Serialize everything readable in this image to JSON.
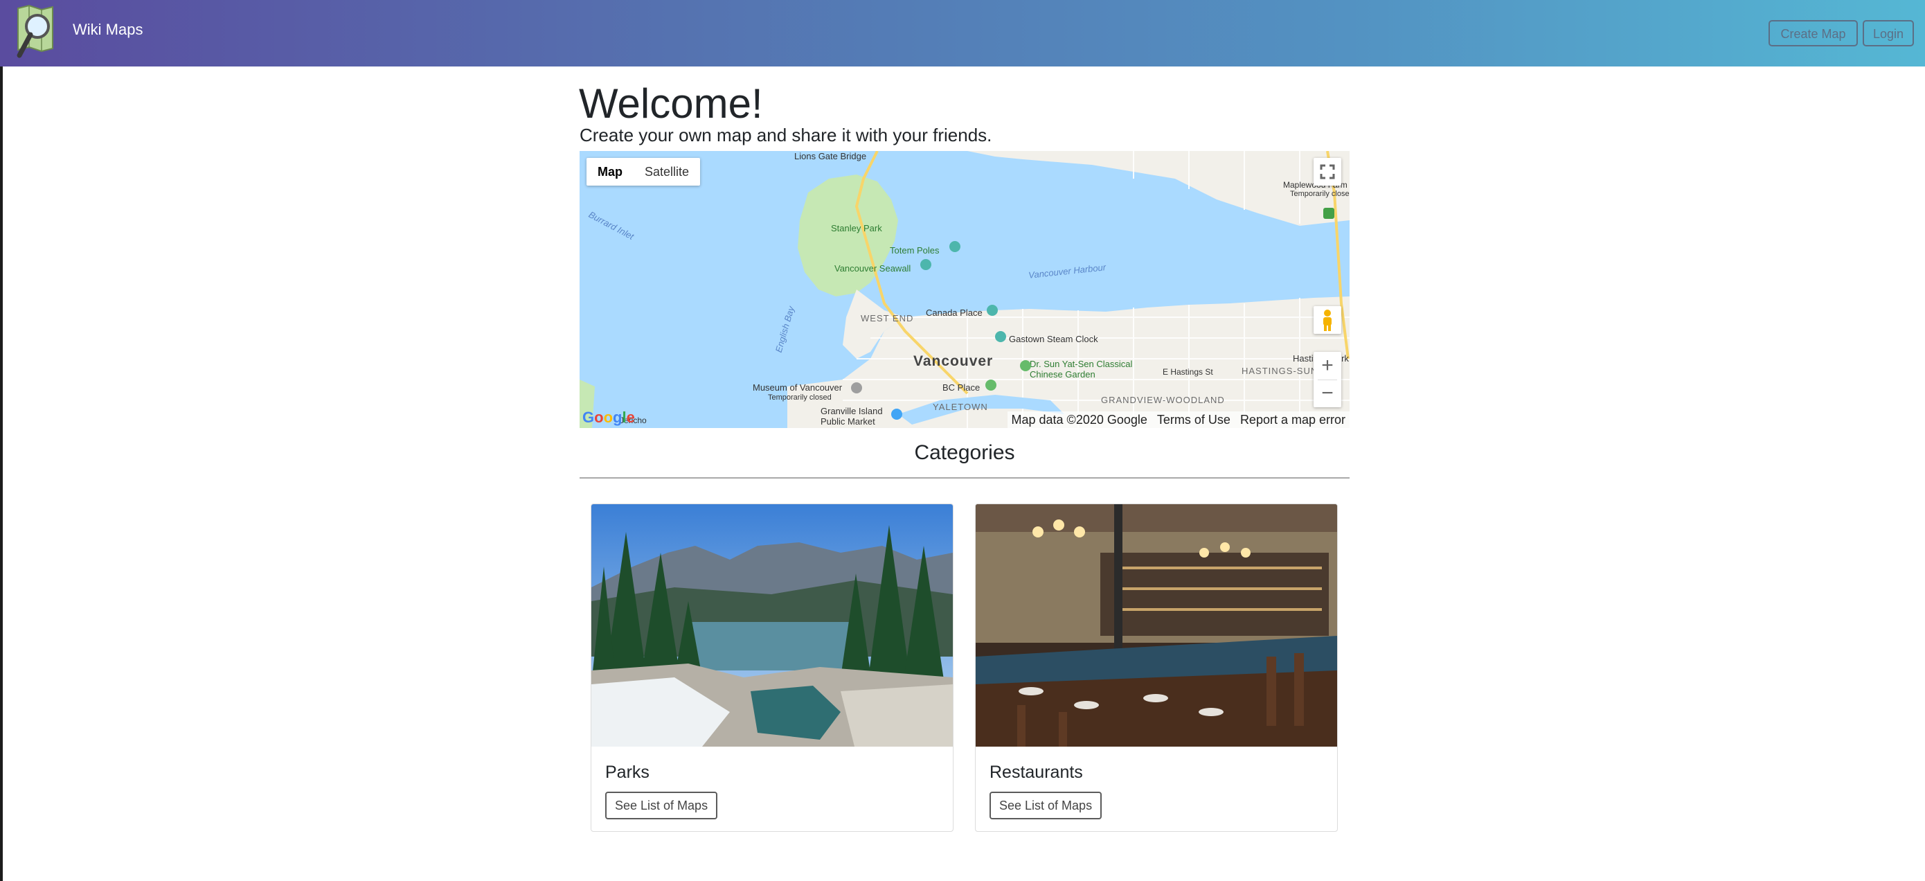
{
  "navbar": {
    "brand": "Wiki Maps",
    "logo_icon": "map-magnifier-logo",
    "create_map_label": "Create Map",
    "login_label": "Login"
  },
  "hero": {
    "title": "Welcome!",
    "subtitle": "Create your own map and share it with your friends."
  },
  "map": {
    "type_options": [
      "Map",
      "Satellite"
    ],
    "selected_type": "Map",
    "labels": {
      "lions_gate": "Lions Gate Bridge",
      "stanley_park": "Stanley Park",
      "totem_poles": "Totem Poles",
      "seawall": "Vancouver Seawall",
      "burrard_inlet": "Burrard Inlet",
      "vancouver_harbour": "Vancouver Harbour",
      "english_bay": "English Bay",
      "canada_place": "Canada Place",
      "west_end": "WEST END",
      "gastown": "Gastown Steam Clock",
      "vancouver": "Vancouver",
      "sun_yat_sen": "Dr. Sun Yat-Sen Classical Chinese Garden",
      "bc_place": "BC Place",
      "yaletown": "YALETOWN",
      "museum": "Museum of Vancouver",
      "museum_status": "Temporarily closed",
      "granville": "Granville Island Public Market",
      "grandview": "GRANDVIEW-WOODLAND",
      "hastings_sunrise": "HASTINGS-SUNRISE",
      "hastings_park": "Hastings Park",
      "e_hastings": "E Hastings St",
      "maplewood": "Maplewood Farm",
      "maplewood_status": "Temporarily closed",
      "jericho": "Jericho"
    },
    "attribution": [
      "Map data ©2020 Google",
      "Terms of Use",
      "Report a map error"
    ],
    "google_logo": "Google"
  },
  "categories": {
    "heading": "Categories",
    "items": [
      {
        "title": "Parks",
        "button": "See List of Maps"
      },
      {
        "title": "Restaurants",
        "button": "See List of Maps"
      }
    ]
  },
  "colors": {
    "nav_gradient_start": "#5a4c9f",
    "nav_gradient_end": "#55b7d4",
    "water": "#aadaff",
    "land": "#f2f0ea",
    "park": "#c6e8b4"
  }
}
